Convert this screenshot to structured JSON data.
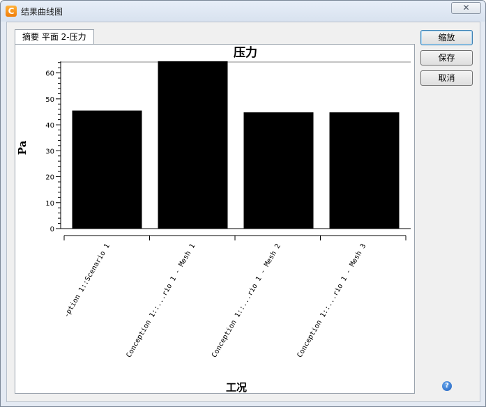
{
  "window": {
    "title": "结果曲线图",
    "app_icon_glyph": "C",
    "close_glyph": "✕"
  },
  "tab": {
    "label": "摘要 平面 2-压力"
  },
  "buttons": {
    "zoom": "缩放",
    "save": "保存",
    "cancel": "取消"
  },
  "help_glyph": "?",
  "chart_data": {
    "type": "bar",
    "title": "压力",
    "xlabel": "工况",
    "ylabel": "Pa",
    "ylim": [
      0,
      65
    ],
    "yticks": [
      0,
      10,
      20,
      30,
      40,
      50,
      60
    ],
    "categories": [
      "-ption 1::Scenario 1",
      "Conception 1::...rio 1 - Mesh 1",
      "Conception 1::...rio 1 - Mesh 2",
      "Conception 1::...rio 1 - Mesh 3"
    ],
    "values": [
      45.5,
      64.5,
      44.8,
      44.8
    ],
    "bar_color": "#000000",
    "grid": false,
    "legend": "none"
  }
}
